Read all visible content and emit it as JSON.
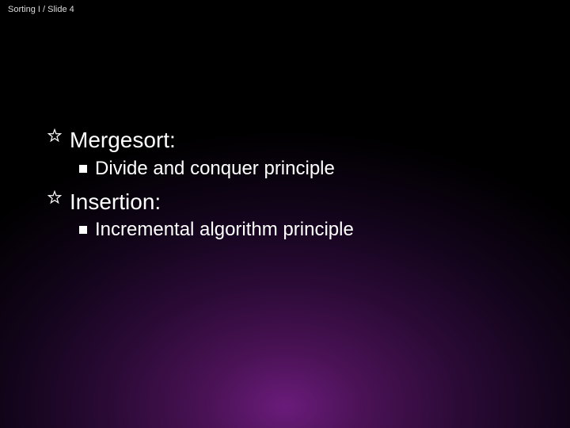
{
  "header": {
    "text": "Sorting I  / Slide 4"
  },
  "content": {
    "items": [
      {
        "label": "Mergesort:",
        "sub": [
          {
            "label": "Divide and conquer principle"
          }
        ]
      },
      {
        "label": "Insertion:",
        "sub": [
          {
            "label": "Incremental algorithm principle"
          }
        ]
      }
    ]
  }
}
